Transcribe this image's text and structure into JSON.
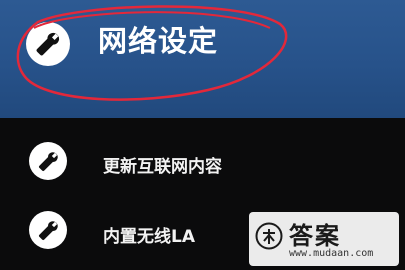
{
  "header": {
    "title": "网络设定",
    "icon": "wrench-icon"
  },
  "menu": {
    "items": [
      {
        "label": "更新互联网内容",
        "icon": "wrench-icon"
      },
      {
        "label": "内置无线LA",
        "icon": "wrench-icon"
      }
    ]
  },
  "watermark": {
    "text": "答案",
    "url": "www.mudaan.com"
  },
  "colors": {
    "header_bg": "#2a5690",
    "body_bg": "#0b0b0c",
    "annotation": "#e3283a",
    "text": "#ffffff"
  }
}
